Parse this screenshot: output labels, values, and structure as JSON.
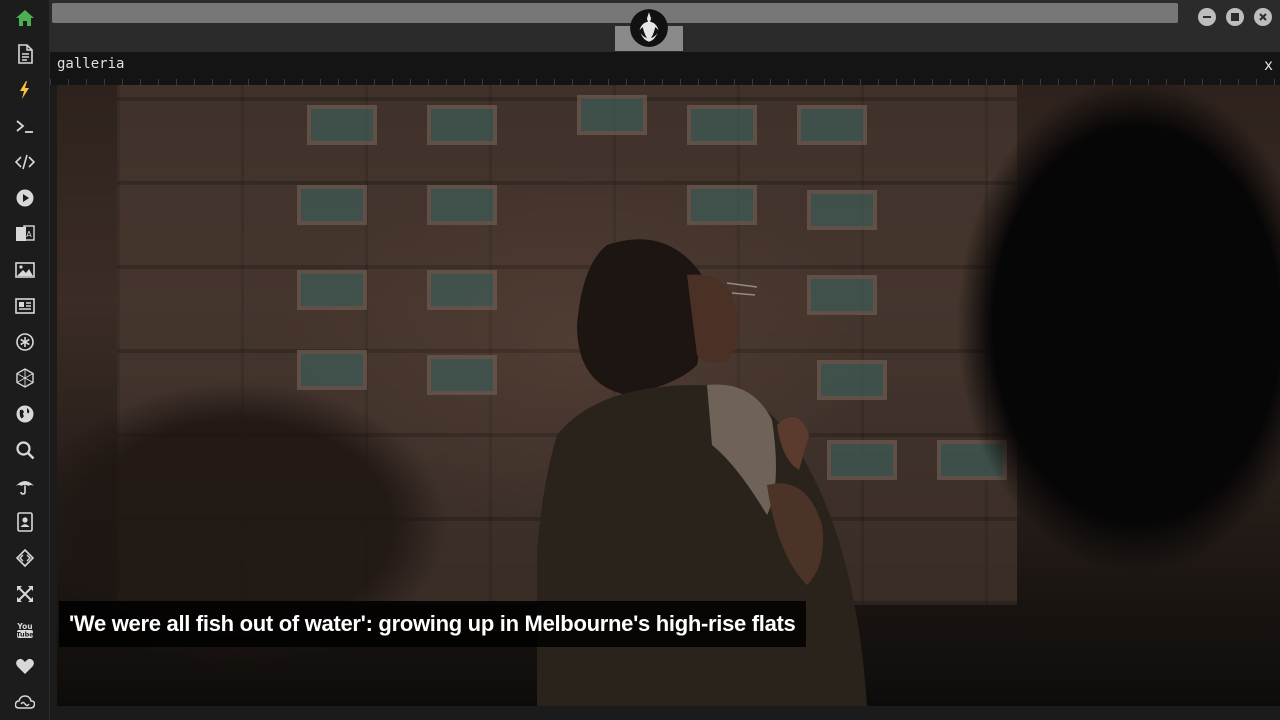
{
  "sidebar": {
    "items": [
      {
        "icon": "home-icon",
        "color": "#4caf50"
      },
      {
        "icon": "document-icon",
        "color": "#d8d8d8"
      },
      {
        "icon": "lightning-icon",
        "color": "#f5c542"
      },
      {
        "icon": "terminal-icon",
        "color": "#d8d8d8"
      },
      {
        "icon": "code-icon",
        "color": "#d8d8d8"
      },
      {
        "icon": "play-icon",
        "color": "#d8d8d8"
      },
      {
        "icon": "translate-icon",
        "color": "#d8d8d8"
      },
      {
        "icon": "image-icon",
        "color": "#d8d8d8"
      },
      {
        "icon": "newspaper-icon",
        "color": "#d8d8d8"
      },
      {
        "icon": "asterisk-icon",
        "color": "#d8d8d8"
      },
      {
        "icon": "hexagon-icon",
        "color": "#d8d8d8"
      },
      {
        "icon": "globe-icon",
        "color": "#d8d8d8"
      },
      {
        "icon": "search-icon",
        "color": "#d8d8d8"
      },
      {
        "icon": "umbrella-icon",
        "color": "#d8d8d8"
      },
      {
        "icon": "contact-book-icon",
        "color": "#d8d8d8"
      },
      {
        "icon": "diamond-code-icon",
        "color": "#d8d8d8"
      },
      {
        "icon": "expand-icon",
        "color": "#d8d8d8"
      },
      {
        "icon": "youtube-icon",
        "color": "#d8d8d8"
      },
      {
        "icon": "heart-icon",
        "color": "#d8d8d8"
      },
      {
        "icon": "cloud-icon",
        "color": "#d8d8d8"
      }
    ]
  },
  "window": {
    "logo_icon": "rebel-alliance-icon",
    "controls": [
      "minimize-icon",
      "maximize-icon",
      "close-icon"
    ]
  },
  "panel": {
    "title": "galleria",
    "close_label": "x"
  },
  "gallery": {
    "caption": "'We were all fish out of water': growing up in Melbourne's high-rise flats"
  }
}
